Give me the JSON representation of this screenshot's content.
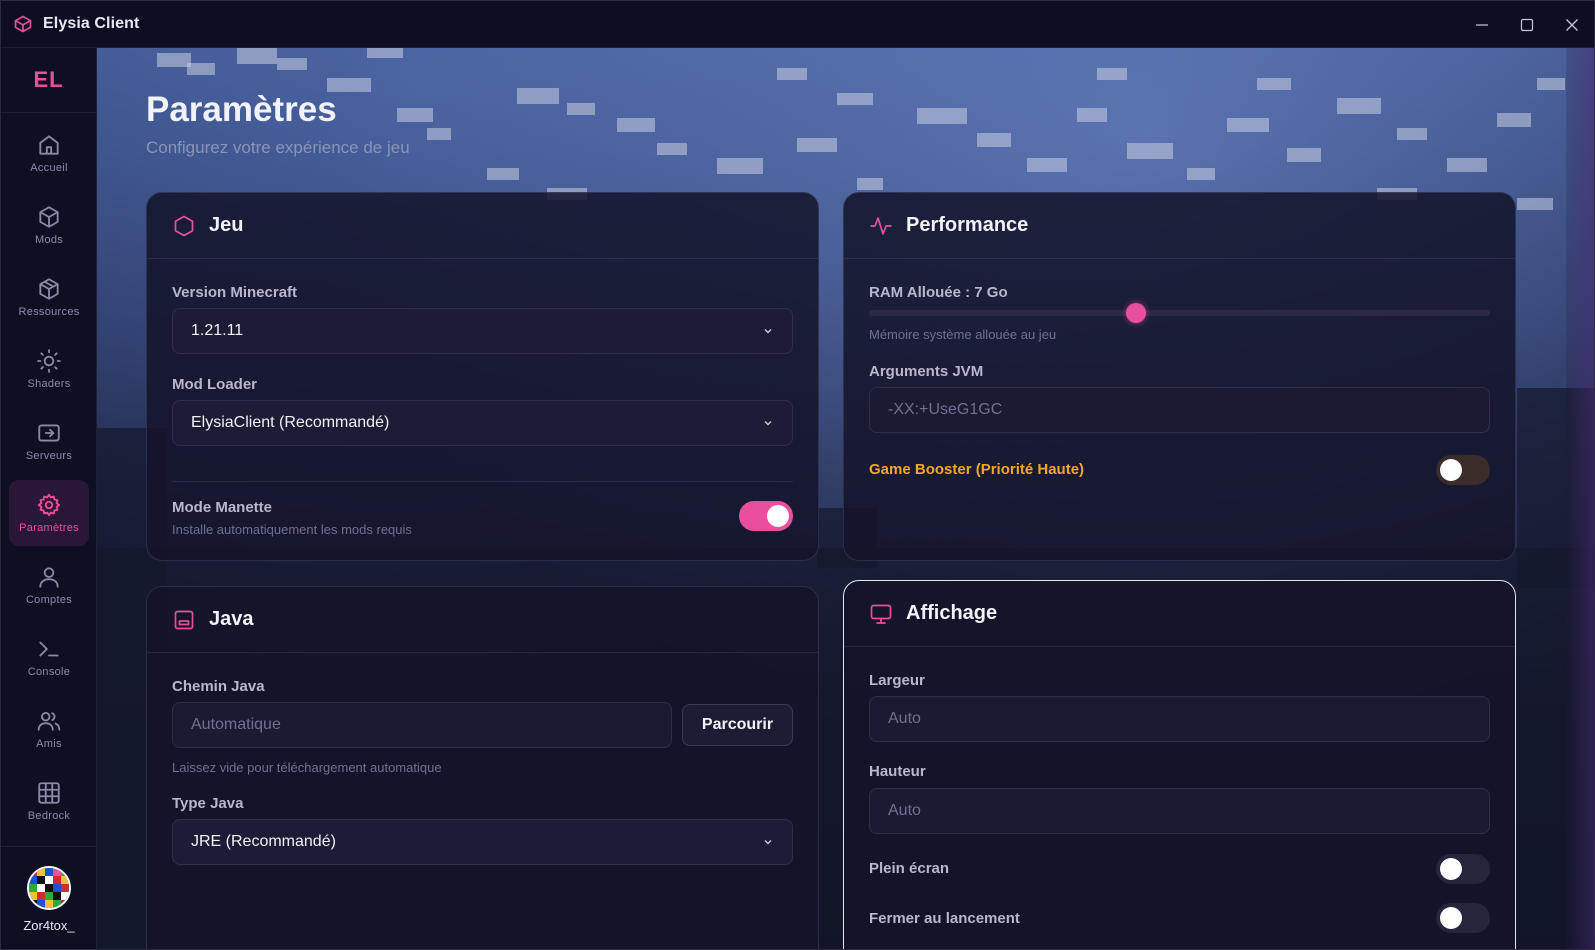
{
  "app": {
    "title": "Elysia Client"
  },
  "brand": {
    "logo_text": "EL"
  },
  "colors": {
    "accent": "#e94f9c",
    "warning": "#f5a623"
  },
  "sidebar": {
    "items": [
      {
        "label": "Accueil",
        "icon": "home-icon"
      },
      {
        "label": "Mods",
        "icon": "cube-icon"
      },
      {
        "label": "Ressources",
        "icon": "box-icon"
      },
      {
        "label": "Shaders",
        "icon": "sun-icon"
      },
      {
        "label": "Serveurs",
        "icon": "server-icon"
      },
      {
        "label": "Paramètres",
        "icon": "gear-icon",
        "active": true
      },
      {
        "label": "Comptes",
        "icon": "user-icon"
      },
      {
        "label": "Console",
        "icon": "terminal-icon"
      },
      {
        "label": "Amis",
        "icon": "users-icon"
      },
      {
        "label": "Bedrock",
        "icon": "grid-icon"
      }
    ],
    "username": "Zor4tox_"
  },
  "page": {
    "title": "Paramètres",
    "subtitle": "Configurez votre expérience de jeu"
  },
  "game": {
    "title": "Jeu",
    "version_label": "Version Minecraft",
    "version_value": "1.21.11",
    "loader_label": "Mod Loader",
    "loader_value": "ElysiaClient (Recommandé)",
    "controller_label": "Mode Manette",
    "controller_help": "Installe automatiquement les mods requis",
    "controller_on": true
  },
  "performance": {
    "title": "Performance",
    "ram_label": "RAM Allouée : 7 Go",
    "ram_value_gb": 7,
    "ram_fraction": 0.43,
    "ram_help": "Mémoire système allouée au jeu",
    "jvm_label": "Arguments JVM",
    "jvm_placeholder": "-XX:+UseG1GC",
    "booster_label": "Game Booster (Priorité Haute)",
    "booster_on": false
  },
  "java": {
    "title": "Java",
    "path_label": "Chemin Java",
    "path_placeholder": "Automatique",
    "browse_label": "Parcourir",
    "path_help": "Laissez vide pour téléchargement automatique",
    "type_label": "Type Java",
    "type_value": "JRE (Recommandé)"
  },
  "display": {
    "title": "Affichage",
    "width_label": "Largeur",
    "width_placeholder": "Auto",
    "height_label": "Hauteur",
    "height_placeholder": "Auto",
    "fullscreen_label": "Plein écran",
    "fullscreen_on": false,
    "close_on_launch_label": "Fermer au lancement",
    "close_on_launch_on": false
  }
}
